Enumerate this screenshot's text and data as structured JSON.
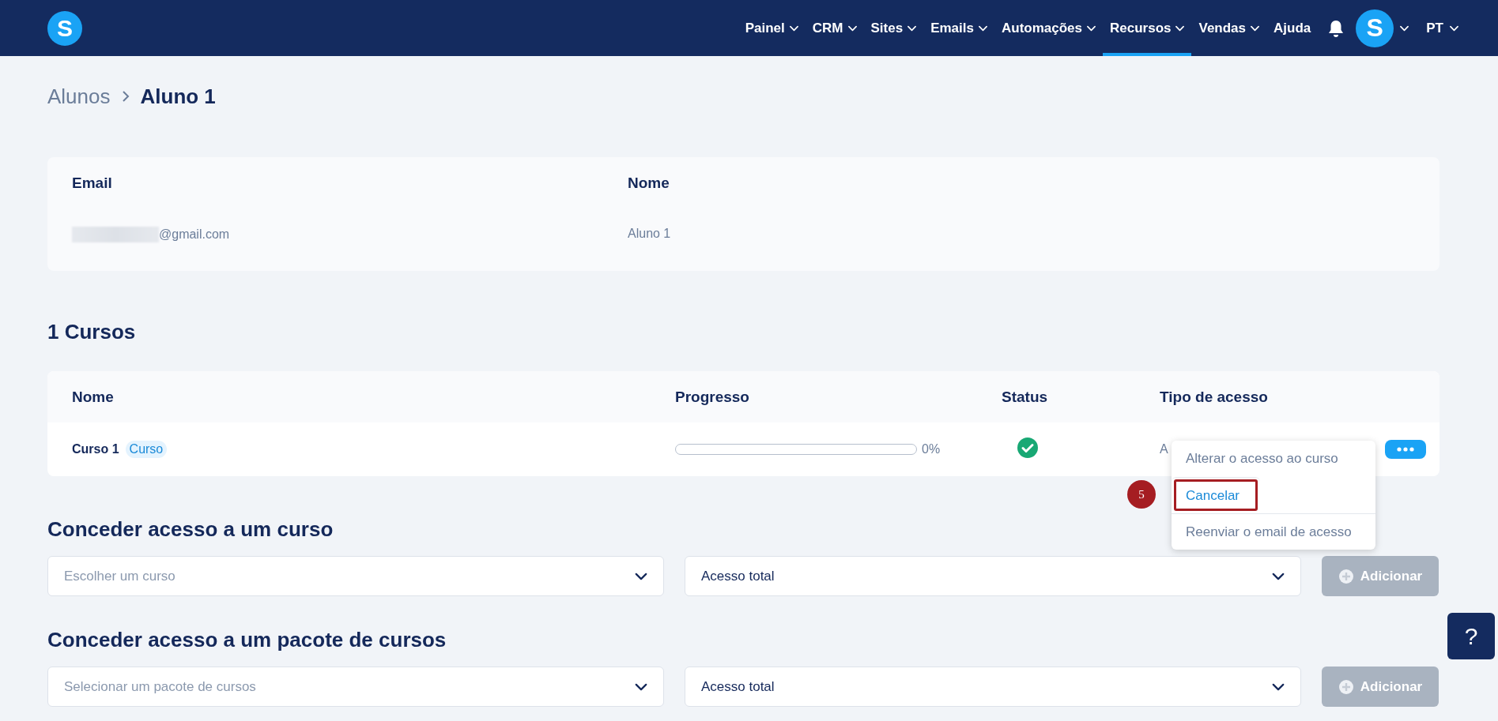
{
  "nav": {
    "logo": "S",
    "items": [
      {
        "label": "Painel",
        "has_menu": true,
        "selected": false
      },
      {
        "label": "CRM",
        "has_menu": true,
        "selected": false
      },
      {
        "label": "Sites",
        "has_menu": true,
        "selected": false
      },
      {
        "label": "Emails",
        "has_menu": true,
        "selected": false
      },
      {
        "label": "Automações",
        "has_menu": true,
        "selected": false
      },
      {
        "label": "Recursos",
        "has_menu": true,
        "selected": true
      },
      {
        "label": "Vendas",
        "has_menu": true,
        "selected": false
      },
      {
        "label": "Ajuda",
        "has_menu": false,
        "selected": false
      }
    ],
    "avatar": "S",
    "language": "PT"
  },
  "breadcrumb": [
    "Alunos",
    "Aluno 1"
  ],
  "student": {
    "columns": [
      "Email",
      "Nome"
    ],
    "email": "@gmail.com",
    "email_redacted": true,
    "name": "Aluno 1"
  },
  "courses_title": "1 Cursos",
  "courses": {
    "columns": [
      "Nome",
      "Progresso",
      "Status",
      "Tipo de acesso"
    ],
    "rows": [
      {
        "name": "Curso 1",
        "tag": "Curso",
        "level": 0,
        "reading": "0%",
        "status_ok": true,
        "access": "A"
      }
    ]
  },
  "row_menu": {
    "items": [
      {
        "label": "Alterar o acesso ao curso",
        "highlighted": false
      },
      {
        "label": "Cancelar",
        "highlighted": true
      },
      {
        "label": "Reenviar o email de acesso",
        "highlighted": false
      }
    ],
    "step_marker": "5"
  },
  "grant_sections": [
    {
      "title": "Conceder acesso a um curso",
      "select": {
        "placeholder": "Escolher um curso"
      },
      "access": {
        "value": "Acesso total"
      },
      "button": {
        "label": "Adicionar",
        "disabled": true
      }
    },
    {
      "title": "Conceder acesso a um pacote de cursos",
      "select": {
        "placeholder": "Selecionar um pacote de cursos"
      },
      "access": {
        "value": "Acesso total"
      },
      "button": {
        "label": "Adicionar",
        "disabled": true
      }
    }
  ],
  "help_button": "?"
}
